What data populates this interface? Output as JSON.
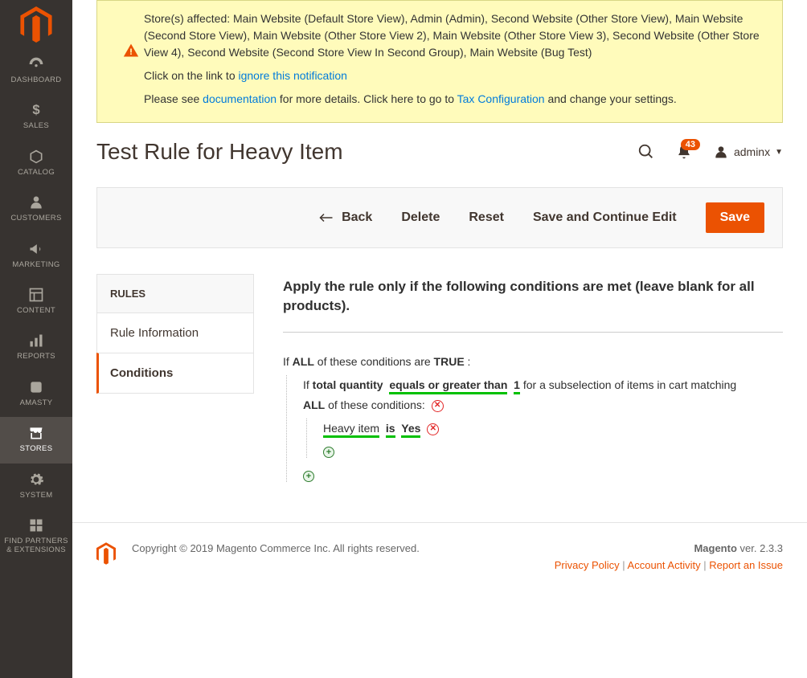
{
  "sidebar": {
    "items": [
      {
        "label": "DASHBOARD",
        "icon": "dashboard"
      },
      {
        "label": "SALES",
        "icon": "dollar"
      },
      {
        "label": "CATALOG",
        "icon": "box"
      },
      {
        "label": "CUSTOMERS",
        "icon": "person"
      },
      {
        "label": "MARKETING",
        "icon": "megaphone"
      },
      {
        "label": "CONTENT",
        "icon": "layout"
      },
      {
        "label": "REPORTS",
        "icon": "chart"
      },
      {
        "label": "AMASTY",
        "icon": "amasty"
      },
      {
        "label": "STORES",
        "icon": "store",
        "active": true
      },
      {
        "label": "SYSTEM",
        "icon": "gear"
      },
      {
        "label": "FIND PARTNERS & EXTENSIONS",
        "icon": "blocks"
      }
    ]
  },
  "notification": {
    "stores_line": "Store(s) affected: Main Website (Default Store View), Admin (Admin), Second Website (Other Store View), Main Website (Second Store View), Main Website (Other Store View 2), Main Website (Other Store View 3), Second Website (Other Store View 4), Second Website (Second Store View In Second Group), Main Website (Bug Test)",
    "click_pre": "Click on the link to ",
    "ignore_link": "ignore this notification",
    "please_pre": "Please see ",
    "doc_link": "documentation",
    "please_mid": " for more details. Click here to go to ",
    "tax_link": "Tax Configuration",
    "please_post": " and change your settings."
  },
  "page_title": "Test Rule for Heavy Item",
  "header": {
    "notif_count": "43",
    "username": "adminx"
  },
  "actions": {
    "back": "Back",
    "delete": "Delete",
    "reset": "Reset",
    "save_continue": "Save and Continue Edit",
    "save": "Save"
  },
  "tabs": {
    "header": "RULES",
    "rule_info": "Rule Information",
    "conditions": "Conditions"
  },
  "rules": {
    "heading": "Apply the rule only if the following conditions are met (leave blank for all products).",
    "line1_pre": "If ",
    "line1_all": "ALL",
    "line1_mid": "  of these conditions are ",
    "line1_true": "TRUE",
    "line1_post": " :",
    "line2_pre": "If ",
    "line2_qty": "total quantity",
    "line2_op": "equals or greater than",
    "line2_val": "1",
    "line2_post": "  for a subselection of items in cart matching ",
    "line3_all": "ALL",
    "line3_post": "  of these conditions:",
    "line4_attr": "Heavy item",
    "line4_is": "is",
    "line4_val": "Yes"
  },
  "footer": {
    "copyright": "Copyright © 2019 Magento Commerce Inc. All rights reserved.",
    "product": "Magento",
    "version": " ver. 2.3.3",
    "privacy": "Privacy Policy",
    "activity": " Account Activity",
    "report": "Report an Issue"
  }
}
